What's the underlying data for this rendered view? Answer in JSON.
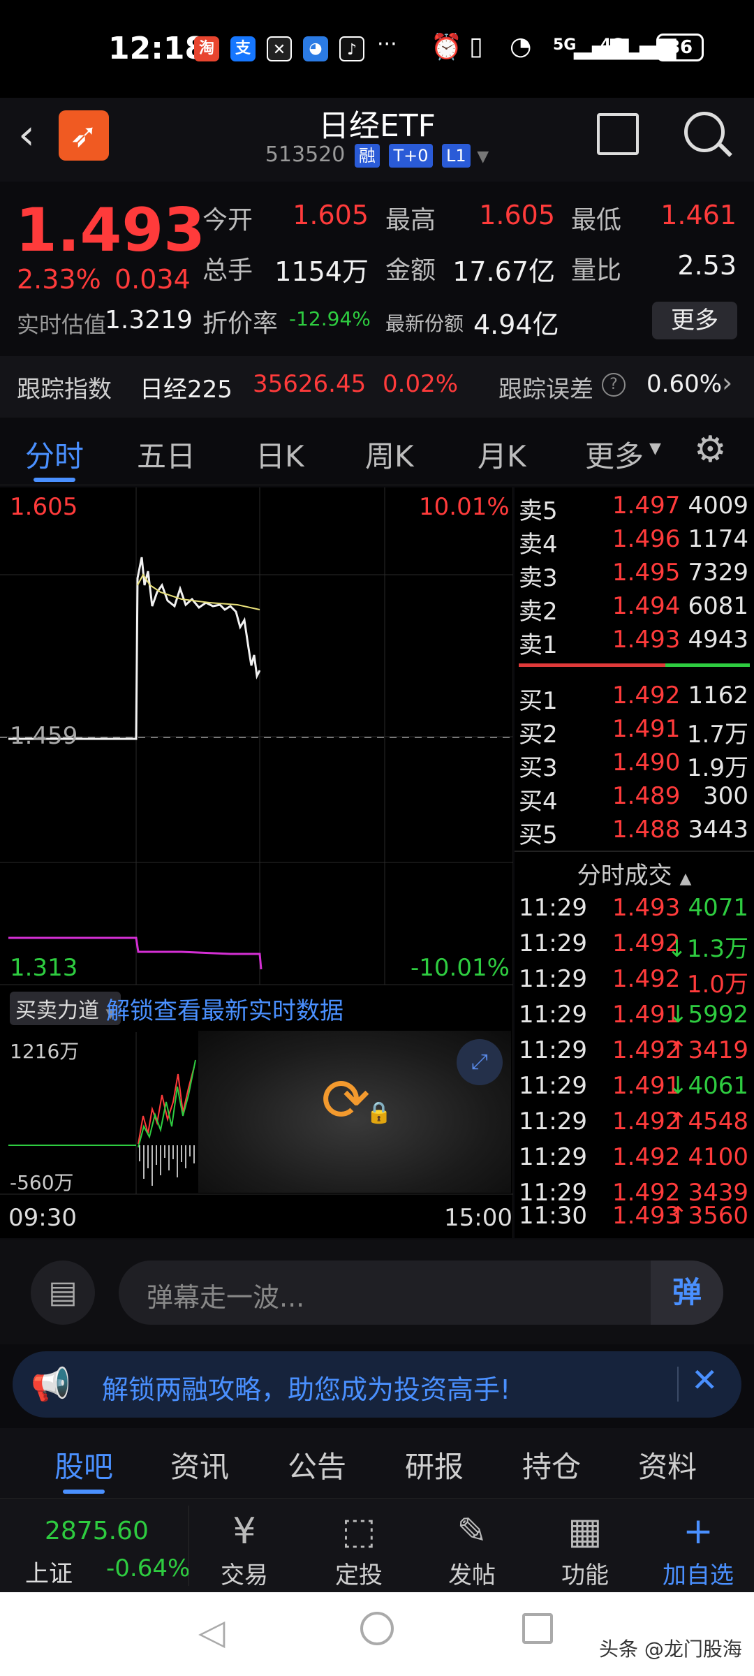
{
  "status_bar": {
    "time": "12:18",
    "battery": "86",
    "net1": "5G",
    "net2": "4G"
  },
  "header": {
    "title": "日经ETF",
    "code": "513520",
    "tags": [
      "融",
      "T+0",
      "L1"
    ]
  },
  "quote": {
    "price": "1.493",
    "change_pct": "2.33%",
    "change": "0.034",
    "rt_est_label": "实时估值",
    "rt_est_value": "1.3219",
    "stats": [
      {
        "label": "今开",
        "value": "1.605"
      },
      {
        "label": "最高",
        "value": "1.605"
      },
      {
        "label": "最低",
        "value": "1.461"
      },
      {
        "label": "总手",
        "value": "1154万"
      },
      {
        "label": "金额",
        "value": "17.67亿"
      },
      {
        "label": "量比",
        "value": "2.53"
      }
    ],
    "discount_label": "折价率",
    "discount_value": "-12.94%",
    "shares_label": "最新份额",
    "shares_value": "4.94亿",
    "more_label": "更多"
  },
  "index_row": {
    "label": "跟踪指数",
    "index_name": "日经225",
    "index_value": "35626.45",
    "index_pct": "0.02%",
    "error_label": "跟踪误差",
    "error_value": "0.60%"
  },
  "tabs": [
    "分时",
    "五日",
    "日K",
    "周K",
    "月K",
    "更多"
  ],
  "chart": {
    "top_price": "1.605",
    "top_pct": "10.01%",
    "mid_price": "1.459",
    "bottom_price": "1.313",
    "bottom_pct": "-10.01%",
    "volume_label": "买卖力道",
    "unlock_text": "解锁查看最新实时数据",
    "vol_top": "1216万",
    "vol_bottom": "-560万",
    "time_start": "09:30",
    "time_end": "15:00"
  },
  "order_book": {
    "asks": [
      {
        "label": "卖5",
        "price": "1.497",
        "vol": "4009"
      },
      {
        "label": "卖4",
        "price": "1.496",
        "vol": "1174"
      },
      {
        "label": "卖3",
        "price": "1.495",
        "vol": "7329"
      },
      {
        "label": "卖2",
        "price": "1.494",
        "vol": "6081"
      },
      {
        "label": "卖1",
        "price": "1.493",
        "vol": "4943"
      }
    ],
    "bids": [
      {
        "label": "买1",
        "price": "1.492",
        "vol": "1162"
      },
      {
        "label": "买2",
        "price": "1.491",
        "vol": "1.7万"
      },
      {
        "label": "买3",
        "price": "1.490",
        "vol": "1.9万"
      },
      {
        "label": "买4",
        "price": "1.489",
        "vol": "300"
      },
      {
        "label": "买5",
        "price": "1.488",
        "vol": "3443"
      }
    ],
    "trades_title": "分时成交",
    "trades": [
      {
        "time": "11:29",
        "price": "1.493",
        "vol": "4071",
        "dir": ""
      },
      {
        "time": "11:29",
        "price": "1.492",
        "vol": "1.3万",
        "dir": "↓"
      },
      {
        "time": "11:29",
        "price": "1.492",
        "vol": "1.0万",
        "dir": ""
      },
      {
        "time": "11:29",
        "price": "1.491",
        "vol": "5992",
        "dir": "↓"
      },
      {
        "time": "11:29",
        "price": "1.492",
        "vol": "3419",
        "dir": "↑"
      },
      {
        "time": "11:29",
        "price": "1.491",
        "vol": "4061",
        "dir": "↓"
      },
      {
        "time": "11:29",
        "price": "1.492",
        "vol": "4548",
        "dir": "↑"
      },
      {
        "time": "11:29",
        "price": "1.492",
        "vol": "4100",
        "dir": ""
      },
      {
        "time": "11:29",
        "price": "1.492",
        "vol": "3439",
        "dir": ""
      },
      {
        "time": "11:30",
        "price": "1.493",
        "vol": "3560",
        "dir": "↑"
      }
    ]
  },
  "danmaku": {
    "placeholder": "弹幕走一波...",
    "button": "弹"
  },
  "banner": {
    "text": "解锁两融攻略，助您成为投资高手!"
  },
  "bottom_tabs": [
    "股吧",
    "资讯",
    "公告",
    "研报",
    "持仓",
    "资料"
  ],
  "app_nav": {
    "index_value": "2875.60",
    "index_name": "上证",
    "index_pct": "-0.64%",
    "items": [
      {
        "label": "交易",
        "icon": "¥"
      },
      {
        "label": "定投",
        "icon": "⬚"
      },
      {
        "label": "发帖",
        "icon": "✎"
      },
      {
        "label": "功能",
        "icon": "▦"
      },
      {
        "label": "加自选",
        "icon": "+"
      }
    ]
  },
  "watermark": "头条 @龙门股海"
}
